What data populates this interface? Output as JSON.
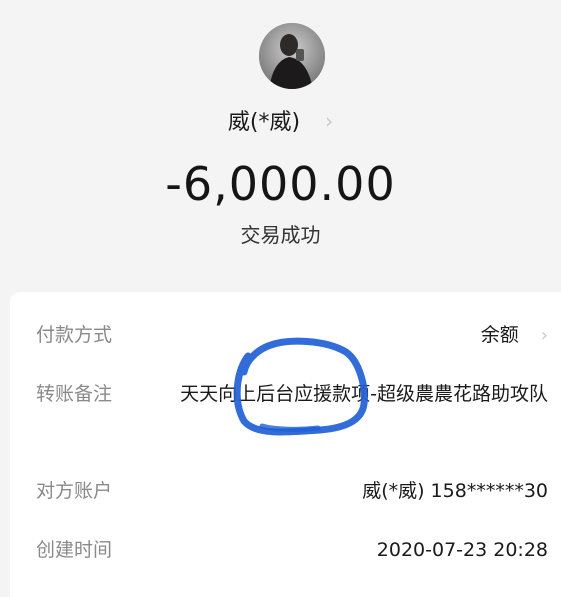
{
  "header": {
    "payee_name": "威(*威)",
    "amount": "-6,000.00",
    "status": "交易成功"
  },
  "details": {
    "payment_method": {
      "label": "付款方式",
      "value": "余额"
    },
    "memo": {
      "label": "转账备注",
      "value": "天天向上后台应援款项-超级農農花路助攻队"
    },
    "counterpart": {
      "label": "对方账户",
      "value": "威(*威) 158******30"
    },
    "created_time": {
      "label": "创建时间",
      "value": "2020-07-23 20:28"
    }
  },
  "colors": {
    "background": "#f4f4f4",
    "card": "#ffffff",
    "label": "#8a8a8a",
    "annotation": "#1f5fd6"
  },
  "icons": [
    "avatar",
    "chevron-right-icon",
    "pen-annotation"
  ]
}
